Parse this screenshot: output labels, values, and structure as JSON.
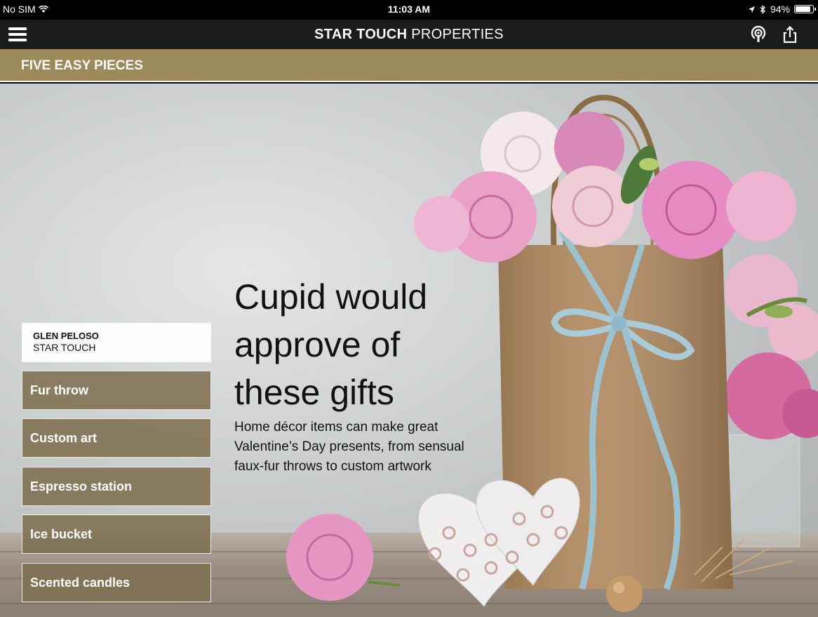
{
  "status_bar": {
    "carrier": "No SIM",
    "time": "11:03 AM",
    "battery": "94%",
    "battery_level": 0.94
  },
  "nav": {
    "brand_bold": "STAR TOUCH",
    "brand_regular": "PROPERTIES",
    "icons": [
      "menu-icon",
      "podcast-icon",
      "share-icon"
    ]
  },
  "section": {
    "title": "FIVE EASY PIECES"
  },
  "article": {
    "headline": "Cupid would approve of these gifts",
    "subhead": "Home décor items can make great Valentine’s Day presents, from sensual faux-fur throws to custom artwork"
  },
  "author": {
    "name": "GLEN PELOSO",
    "org": "STAR TOUCH"
  },
  "pieces": [
    {
      "label": "Fur throw"
    },
    {
      "label": "Custom art"
    },
    {
      "label": "Espresso station"
    },
    {
      "label": "Ice bucket"
    },
    {
      "label": "Scented candles"
    }
  ],
  "colors": {
    "section_bar": "#9d8a5a",
    "nav_bar": "#1b1b1b",
    "menu_item": "#7e6f50"
  }
}
